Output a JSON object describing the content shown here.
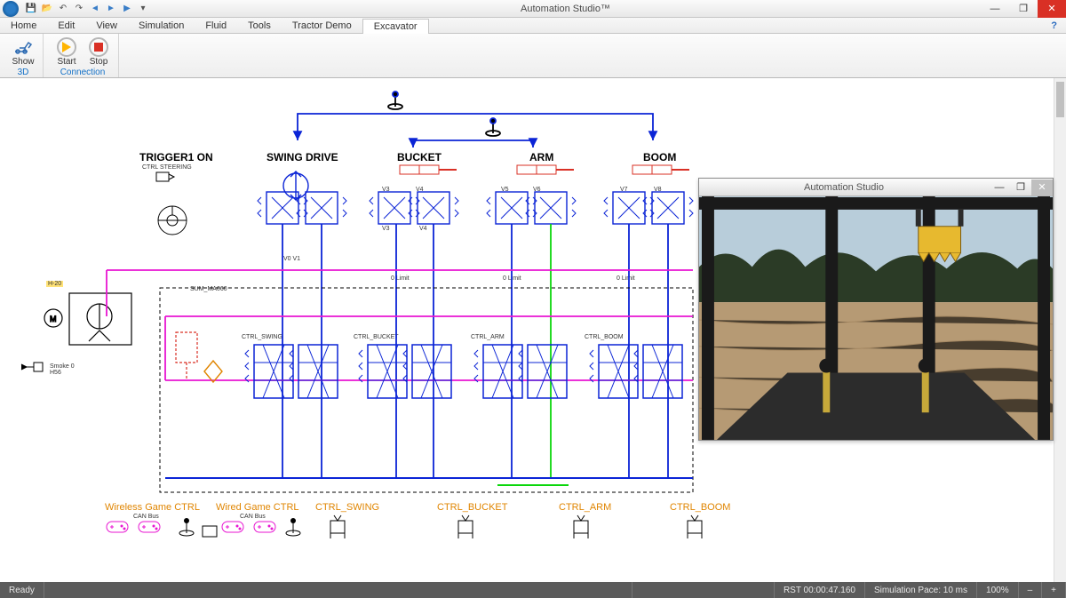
{
  "app_title": "Automation Studio™",
  "qat": [
    "save",
    "open",
    "undo",
    "redo",
    "prev",
    "next",
    "run",
    "dropdown"
  ],
  "menu_tabs": [
    "Home",
    "Edit",
    "View",
    "Simulation",
    "Fluid",
    "Tools",
    "Tractor Demo",
    "Excavator"
  ],
  "active_tab": "Excavator",
  "ribbon": {
    "group1": {
      "name": "3D",
      "buttons": [
        {
          "label": "Show",
          "icon": "excavator"
        }
      ]
    },
    "group2": {
      "name": "Connection",
      "buttons": [
        {
          "label": "Start",
          "icon": "play"
        },
        {
          "label": "Stop",
          "icon": "stop"
        }
      ]
    }
  },
  "diagram": {
    "headings": [
      "TRIGGER1 ON",
      "SWING DRIVE",
      "BUCKET",
      "ARM",
      "BOOM"
    ],
    "sub_labels": {
      "trigger_sub": "CTRL STEERING",
      "smoke": "Smoke 0\nH56",
      "hpump": "H-20",
      "motor": "M",
      "valve_ids": {
        "swing": [
          "V0",
          "V1"
        ],
        "bucket": [
          "V3",
          "V4"
        ],
        "arm": [
          "V5",
          "V6"
        ],
        "boom": [
          "V7",
          "V8"
        ]
      },
      "limits": [
        "0 Limit",
        "0 Limit",
        "0 Limit"
      ],
      "ctrl_tags": [
        "CTRL_SWING",
        "CTRL_BUCKET",
        "CTRL_ARM",
        "CTRL_BOOM"
      ],
      "sum": "SUM_MA060"
    },
    "footer_controls": {
      "wireless": {
        "title": "Wireless Game CTRL",
        "sub": "CAN Bus"
      },
      "wired": {
        "title": "Wired Game CTRL",
        "sub": "CAN Bus"
      },
      "swing": "CTRL_SWING",
      "bucket": "CTRL_BUCKET",
      "arm": "CTRL_ARM",
      "boom": "CTRL_BOOM"
    }
  },
  "float_win_title": "Automation Studio",
  "statusbar": {
    "ready": "Ready",
    "rst": "RST 00:00:47.160",
    "pace": "Simulation Pace: 10 ms",
    "zoom": "100%"
  },
  "colors": {
    "blue": "#0b24d6",
    "magenta": "#e815d2",
    "green": "#0bd60b",
    "red": "#d93025",
    "orange": "#e08500"
  }
}
